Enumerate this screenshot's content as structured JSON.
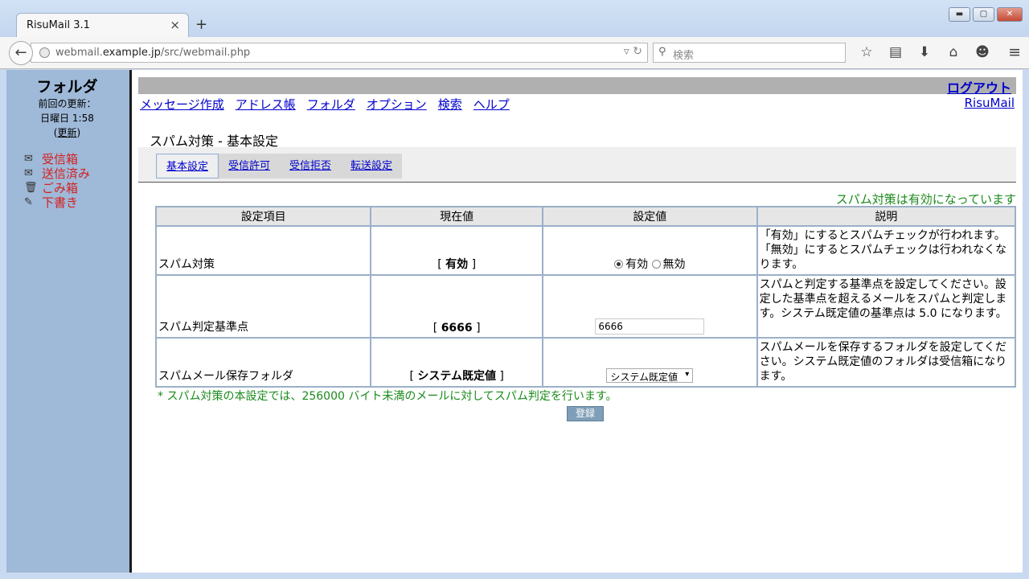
{
  "browser": {
    "tab_title": "RisuMail 3.1",
    "tab_close": "×",
    "new_tab": "+",
    "url_prefix": "webmail.",
    "url_domain": "example.jp",
    "url_path": "/src/webmail.php",
    "search_placeholder": "検索"
  },
  "sidebar": {
    "title": "フォルダ",
    "last_update_label": "前回の更新：",
    "last_update_time": "日曜日 1:58",
    "refresh_open": "(",
    "refresh_label": "更新",
    "refresh_close": ")",
    "folders": [
      {
        "label": "受信箱",
        "icon": "inbox-icon"
      },
      {
        "label": "送信済み",
        "icon": "sent-icon"
      },
      {
        "label": "ごみ箱",
        "icon": "trash-icon"
      },
      {
        "label": "下書き",
        "icon": "drafts-icon"
      }
    ]
  },
  "header": {
    "logout": "ログアウト",
    "brand": "RisuMail",
    "nav": [
      "メッセージ作成",
      "アドレス帳",
      "フォルダ",
      "オプション",
      "検索",
      "ヘルプ"
    ]
  },
  "page": {
    "title": "スパム対策 - 基本設定",
    "subtabs": [
      "基本設定",
      "受信許可",
      "受信拒否",
      "転送設定"
    ],
    "status": "スパム対策は有効になっています",
    "table": {
      "headers": [
        "設定項目",
        "現在値",
        "設定値",
        "説明"
      ],
      "rows": [
        {
          "label": "スパム対策",
          "current": "有効",
          "setting_options": [
            "有効",
            "無効"
          ],
          "selected": "有効",
          "description": "「有効」にするとスパムチェックが行われます。「無効」にするとスパムチェックは行われなくなります。"
        },
        {
          "label": "スパム判定基準点",
          "current": "6666",
          "input_value": "6666",
          "description": "スパムと判定する基準点を設定してください。設定した基準点を超えるメールをスパムと判定します。システム既定値の基準点は 5.0 になります。"
        },
        {
          "label": "スパムメール保存フォルダ",
          "current": "システム既定値",
          "select_value": "システム既定値",
          "description": "スパムメールを保存するフォルダを設定してください。システム既定値のフォルダは受信箱になります。"
        }
      ]
    },
    "note": "* スパム対策の本設定では、256000 バイト未満のメールに対してスパム判定を行います。",
    "submit": "登録"
  }
}
